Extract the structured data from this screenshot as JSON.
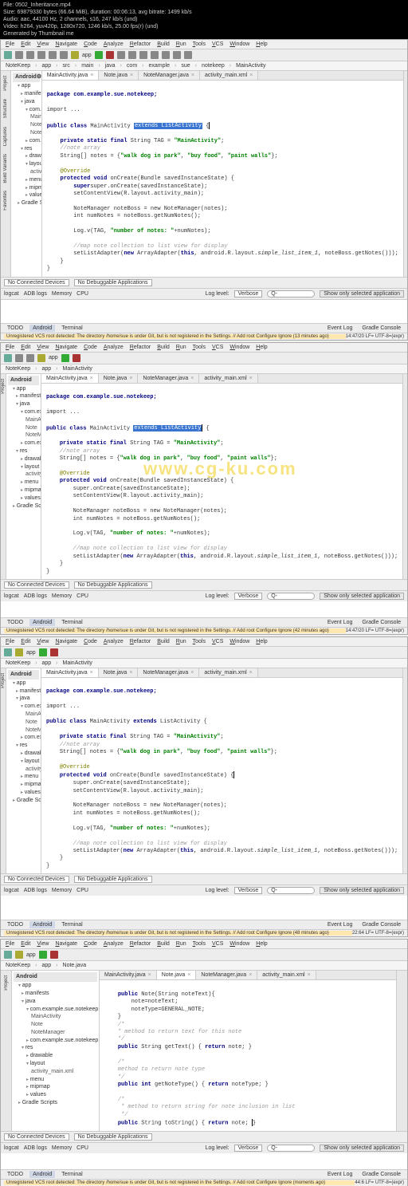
{
  "header": {
    "file": "File: 0502_Inheritance.mp4",
    "size": "Size: 69879330 bytes (66.64 MiB), duration: 00:06:13, avg bitrate: 1499 kb/s",
    "audio": "Audio: aac, 44100 Hz, 2 channels, s16, 247 kb/s (und)",
    "video": "Video: h264, yuv420p, 1280x720, 1246 kb/s, 25.00 fps(r) (und)",
    "gen": "Generated by Thumbnail me"
  },
  "watermark": "www.cg-ku.com",
  "menu": [
    "File",
    "Edit",
    "View",
    "Navigate",
    "Code",
    "Analyze",
    "Refactor",
    "Build",
    "Run",
    "Tools",
    "VCS",
    "Window",
    "Help"
  ],
  "nav": {
    "project": "NoteKeep",
    "module": "app",
    "runcfg": "app"
  },
  "crumbs": [
    "NoteKeep",
    "app",
    "src",
    "main",
    "java",
    "com",
    "example",
    "sue",
    "notekeep",
    "MainActivity"
  ],
  "tree_hdr": {
    "title": "Android",
    "view": "app"
  },
  "tree": [
    {
      "l": 0,
      "t": "app",
      "fldr": 1,
      "open": 1
    },
    {
      "l": 1,
      "t": "manifests",
      "fldr": 1
    },
    {
      "l": 1,
      "t": "java",
      "fldr": 1,
      "open": 1
    },
    {
      "l": 2,
      "t": "com.example.sue.notekeep",
      "fldr": 1,
      "open": 1
    },
    {
      "l": 3,
      "t": "MainActivity"
    },
    {
      "l": 3,
      "t": "Note"
    },
    {
      "l": 3,
      "t": "NoteManager"
    },
    {
      "l": 2,
      "t": "com.example.sue.notekeep (androidTest)",
      "fldr": 1
    },
    {
      "l": 1,
      "t": "res",
      "fldr": 1,
      "open": 1
    },
    {
      "l": 2,
      "t": "drawable",
      "fldr": 1
    },
    {
      "l": 2,
      "t": "layout",
      "fldr": 1,
      "open": 1
    },
    {
      "l": 3,
      "t": "activity_main.xml"
    },
    {
      "l": 2,
      "t": "menu",
      "fldr": 1
    },
    {
      "l": 2,
      "t": "mipmap",
      "fldr": 1
    },
    {
      "l": 2,
      "t": "values",
      "fldr": 1
    },
    {
      "l": 0,
      "t": "Gradle Scripts",
      "fldr": 1
    }
  ],
  "tabs": [
    {
      "name": "MainActivity.java",
      "active": true
    },
    {
      "name": "Note.java"
    },
    {
      "name": "NoteManager.java"
    },
    {
      "name": "activity_main.xml"
    }
  ],
  "p1": {
    "pkg": "package com.example.sue.notekeep;",
    "imp": "import ...",
    "cls_a": "public class",
    "cls_b": "MainActivity",
    "cls_c": "extends ListActivity",
    "cls_d": "{",
    "tag_a": "private static final",
    "tag_b": "String TAG =",
    "tag_c": "\"MainActivity\"",
    "arr_cmt": "//note array",
    "arr_a": "String[]",
    "arr_b": "notes = {",
    "arr_c": "\"walk dog in park\"",
    "arr_d": ", ",
    "arr_e": "\"buy food\"",
    "arr_f": ", ",
    "arr_g": "\"paint walls\"",
    "arr_h": "};",
    "ov": "@Override",
    "oc_a": "protected void",
    "oc_b": "onCreate(Bundle savedInstanceState) {",
    "sup": "super.onCreate(savedInstanceState);",
    "set": "setContentView(R.layout.activity_main);",
    "nm": "NoteManager noteBoss = new NoteManager(notes);",
    "nn": "int numNotes = noteBoss.getNumNotes();",
    "log_a": "Log.v(TAG,",
    "log_b": "\"number of notes: \"",
    "log_c": "+numNotes);",
    "cmt": "//map note collection to list view for display",
    "sla_a": "setListAdapter(",
    "sla_b": "new",
    "sla_c": "ArrayAdapter(",
    "sla_d": "this",
    "sla_e": ", android.R.layout.",
    "sla_f": "simple_list_item_1",
    "sla_g": ", noteBoss.getNotes()));"
  },
  "p4": {
    "c1_a": "public",
    "c1_b": "Note(String noteText){",
    "c1_c": "note=noteText;",
    "c1_d": "noteType=GENERAL_NOTE;",
    "cmt1": "/*\n    * method to return text for this note\n    */",
    "gt_a": "public",
    "gt_b": "String getText() {",
    "gt_c": "return",
    "gt_d": "note; }",
    "cmt2": "/*\n    method to return note type\n    */",
    "gtp_a": "public int",
    "gtp_b": "getNoteType() {",
    "gtp_c": "return",
    "gtp_d": "noteType; }",
    "cmt3": "/*\n     * method to return string for note inclusion in list\n     */",
    "ts_a": "public",
    "ts_b": "String toString() {",
    "ts_c": "return",
    "ts_d": "note; }"
  },
  "bottom": {
    "devices": "No Connected Devices",
    "noapp": "No Debuggable Applications",
    "logcat": "logcat",
    "adb": "ADB logs",
    "mem": "Memory",
    "cpu": "CPU",
    "loglvl": "Log level:",
    "verbose": "Verbose",
    "search": "Q-",
    "only": "Show only selected application",
    "todo": "TODO",
    "android": "Android",
    "terminal": "Terminal",
    "evlog": "Event Log",
    "gradle": "Gradle Console"
  },
  "status": {
    "vcs13": "Unregistered VCS root detected: The directory /home/sue is under Git, but is not registered in the Settings. // Add root  Configure  Ignore (13 minutes ago)",
    "vcs42": "Unregistered VCS root detected: The directory /home/sue is under Git, but is not registered in the Settings. // Add root  Configure  Ignore (42 minutes ago)",
    "vcs48": "Unregistered VCS root detected: The directory /home/sue is under Git, but is not registered in the Settings. // Add root  Configure  Ignore (48 minutes ago)",
    "vcsnow": "Unregistered VCS root detected: The directory /home/sue is under Git, but is not registered in the Settings. // Add root  Configure  Ignore (moments ago)",
    "pos1": "14:47/20  LF=  UTF-8=(expr)",
    "pos3": "22:64  LF=  UTF-8=(expr)",
    "pos4": "44:6  LF=  UTF-8=(expr)"
  }
}
